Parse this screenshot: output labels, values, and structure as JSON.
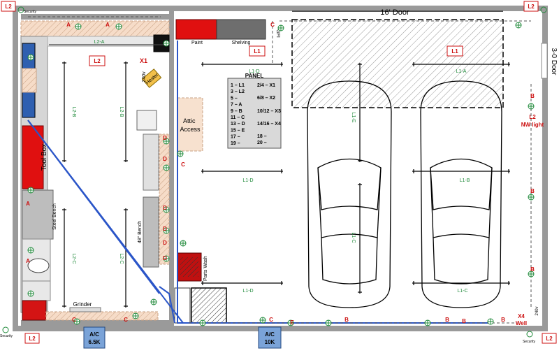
{
  "corner_labels": [
    "L2",
    "L2",
    "L2",
    "L2"
  ],
  "security": "Security",
  "door_16": "16' Door",
  "door_30": "3-0 Door",
  "paint": "Paint",
  "shelving": "Shelving",
  "gfi": "GFI",
  "circuit_L1": "L1",
  "circuit_L2": "L2",
  "x1": "X1",
  "heater": "Heater",
  "v240": "240v",
  "attic_access": "Attic Access",
  "tool_box": "Tool Box",
  "steel_bench": "Steel Bench",
  "bench_48": "48\" Bench",
  "parts_wash": "Parts Wash",
  "grinder": "Grinder",
  "nw_light": "NW light",
  "x4": "X4",
  "well": "Well",
  "panel": {
    "title": "L1-D",
    "subtitle": "PANEL",
    "left": [
      "1 – L1",
      "3 – L2",
      "5 –",
      "7 – A",
      "9 – B",
      "11 – C",
      "13 – D",
      "15 – E",
      "17 –",
      "19 –"
    ],
    "right": [
      "2/4 – X1",
      "6/8 – X2",
      "10/12 – X3",
      "14/16 – X4",
      "18 –",
      "20 –"
    ]
  },
  "ac_units": [
    {
      "line1": "A/C",
      "line2": "6.5K"
    },
    {
      "line1": "A/C",
      "line2": "10K"
    }
  ],
  "fixture_labels": {
    "l2a": "L2-A",
    "l2b": "L2-B",
    "l2c": "L2-C",
    "l1a": "L1-A",
    "l1b": "L1-B",
    "l1c": "L1-C",
    "l1d": "L1-D",
    "l1e": "L1-E"
  },
  "outlet_labels": {
    "a": "A",
    "b": "B",
    "c": "C",
    "d": "D",
    "e": "E"
  },
  "colors": {
    "wall": "#9a9a9a",
    "wire_blue": "#2a55c8",
    "red_label": "#cc1111",
    "green_symbol": "#1f8a3a",
    "equipment_red": "#e01010"
  }
}
